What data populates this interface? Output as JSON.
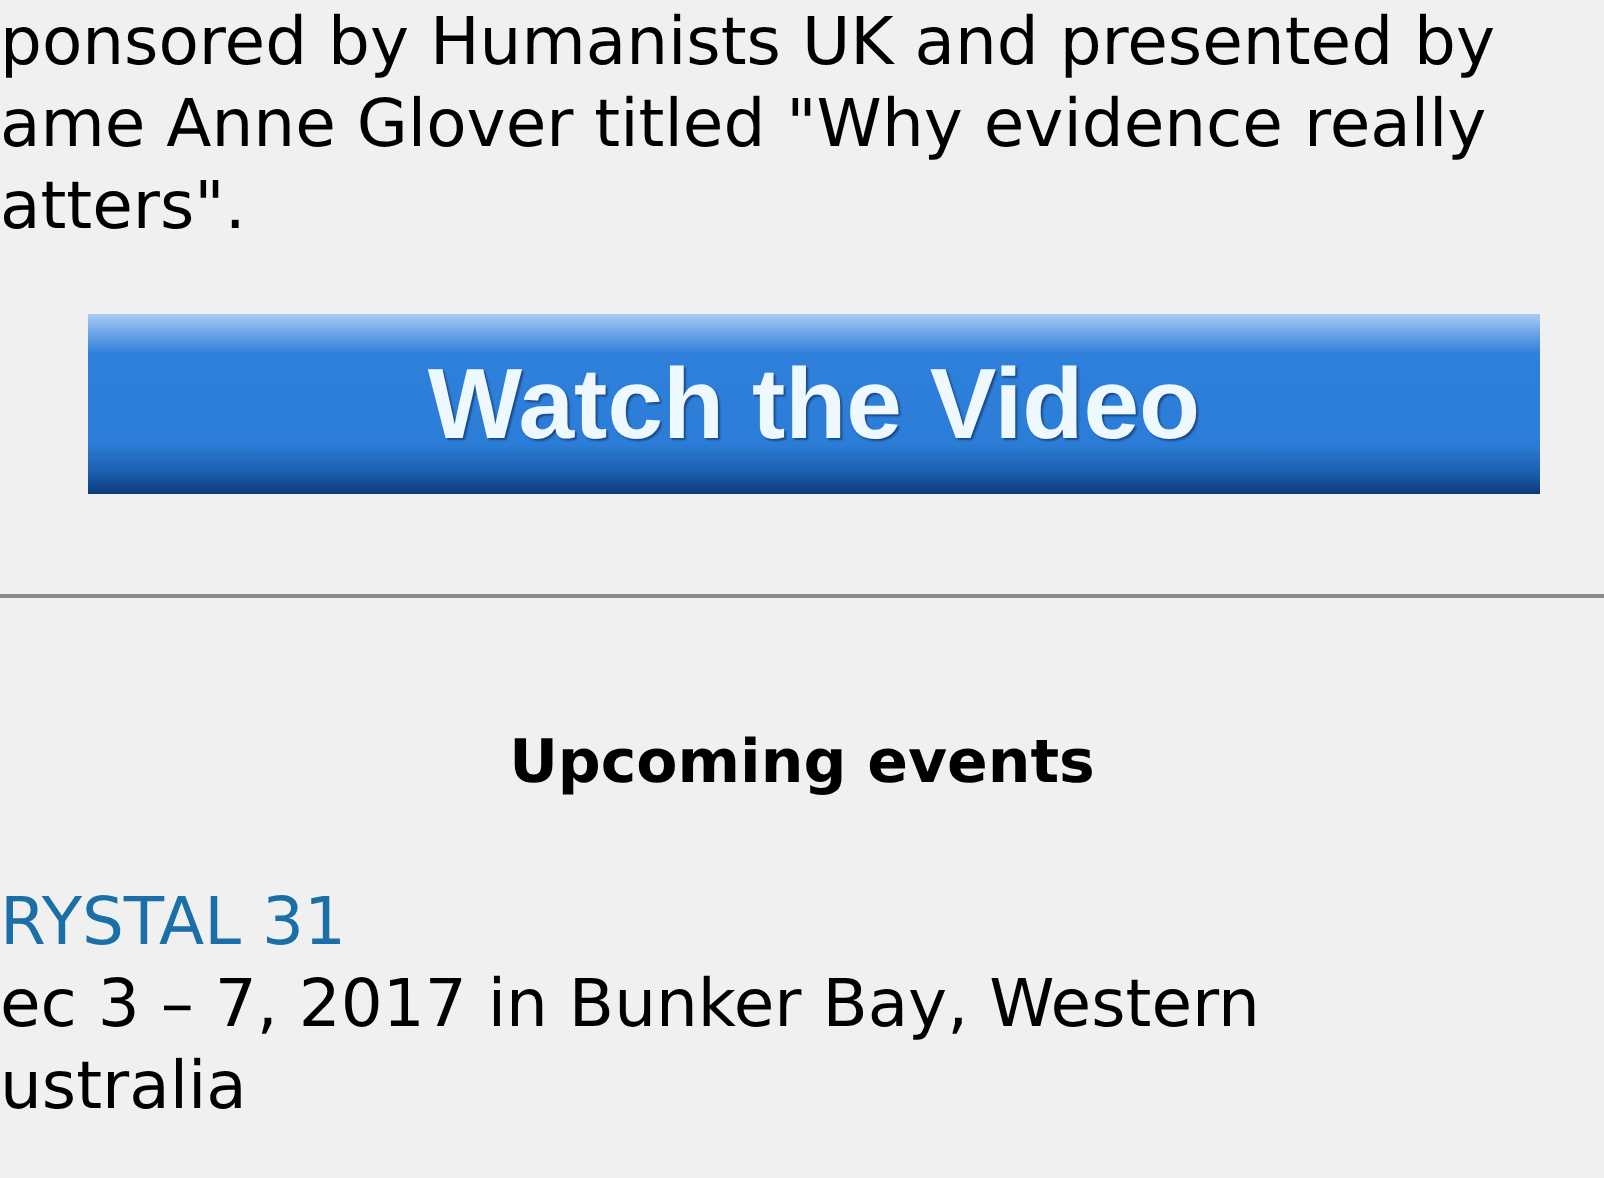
{
  "intro_lines": [
    "ponsored by Humanists UK and presented by",
    "ame Anne Glover titled \"Why evidence really",
    "atters\"."
  ],
  "video_button": {
    "label": "Watch the Video"
  },
  "events_heading": "Upcoming events",
  "events": [
    {
      "title": "RYSTAL 31",
      "detail_lines": [
        "ec 3 – 7, 2017 in Bunker Bay, Western",
        "ustralia"
      ]
    }
  ]
}
